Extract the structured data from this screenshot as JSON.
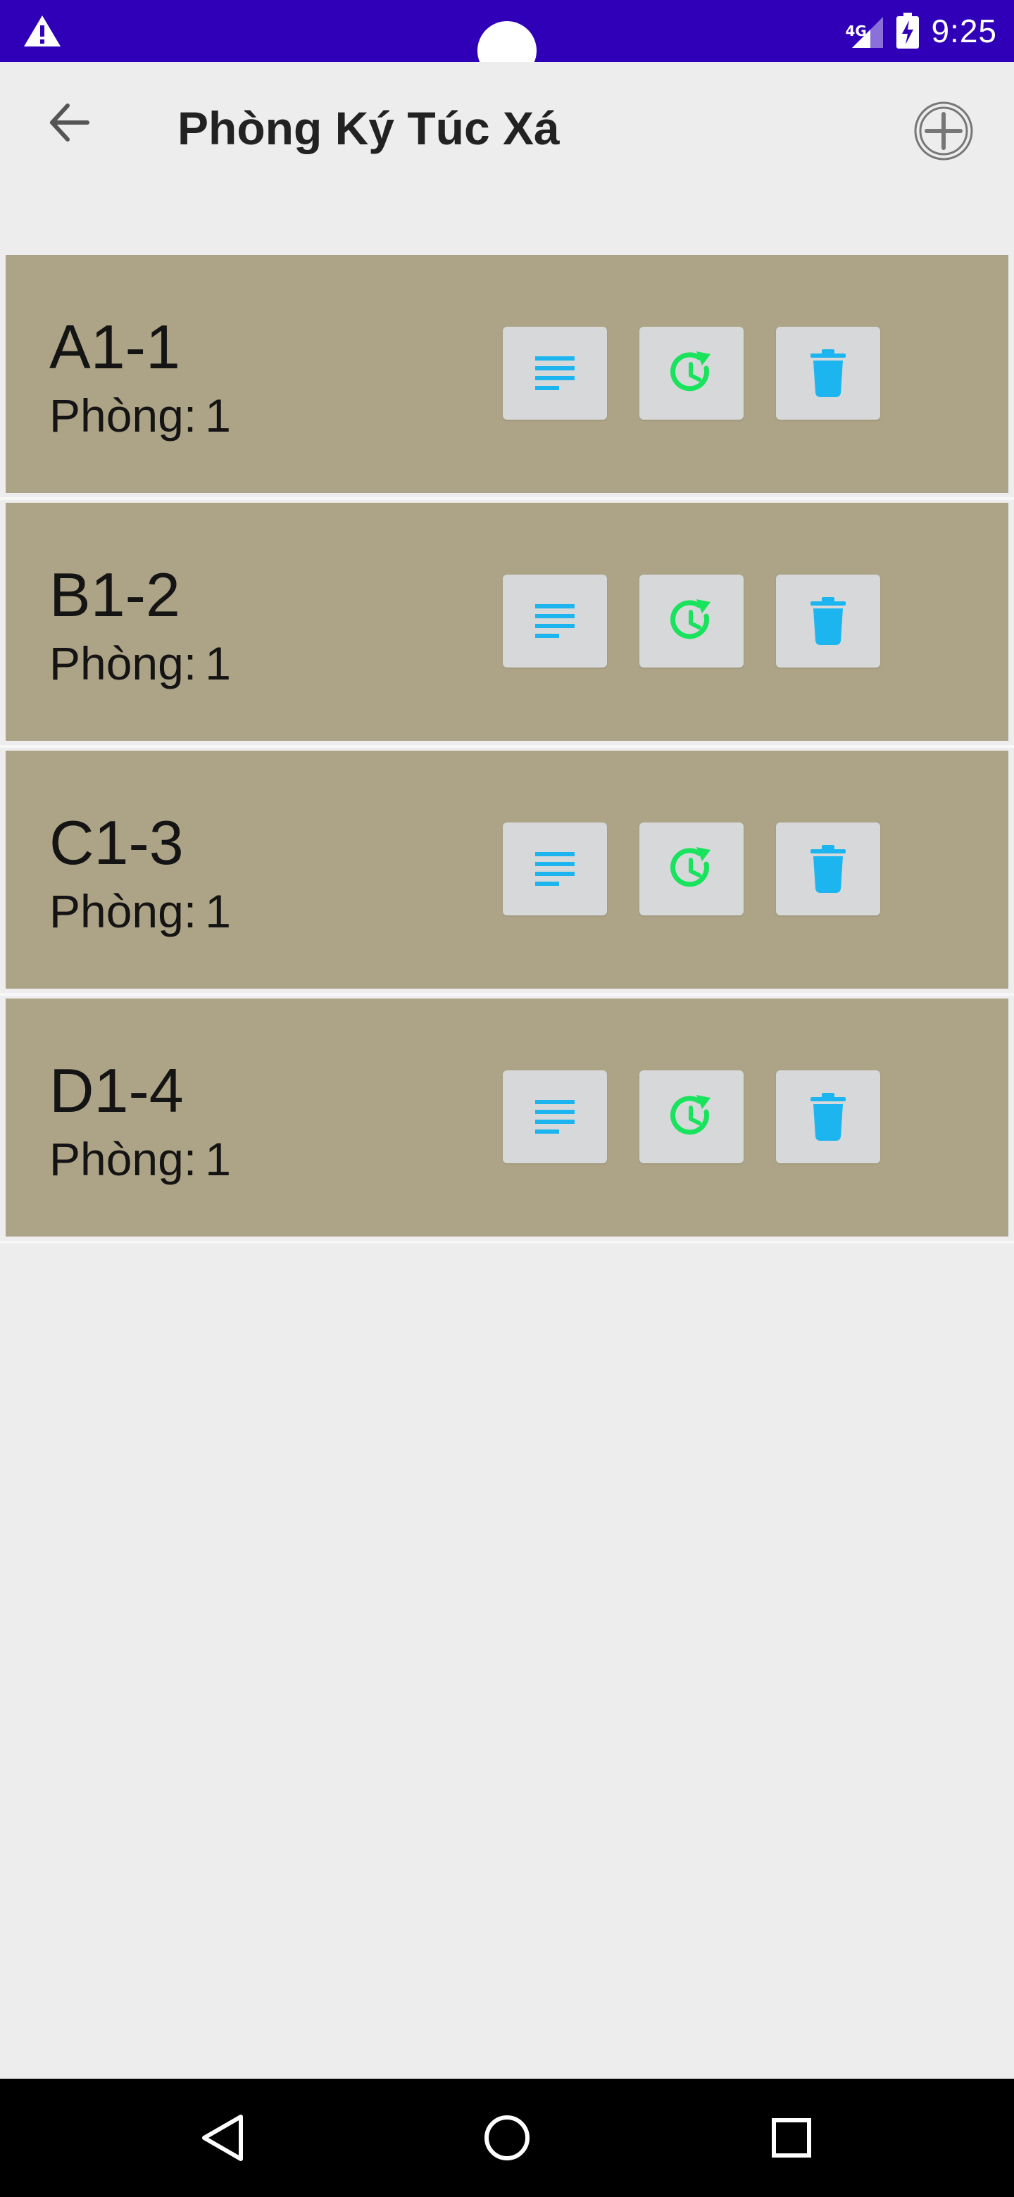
{
  "status_bar": {
    "network": "4G",
    "time": "9:25",
    "icons": [
      "alert-icon",
      "signal-icon",
      "battery-charging-icon"
    ]
  },
  "app_bar": {
    "title": "Phòng Ký Túc Xá",
    "back_icon": "arrow-back-icon",
    "add_icon": "add-circle-icon"
  },
  "rooms": [
    {
      "name": "A1-1",
      "count_label": "Phòng:",
      "count": "1"
    },
    {
      "name": "B1-2",
      "count_label": "Phòng:",
      "count": "1"
    },
    {
      "name": "C1-3",
      "count_label": "Phòng:",
      "count": "1"
    },
    {
      "name": "D1-4",
      "count_label": "Phòng:",
      "count": "1"
    }
  ],
  "room_actions": {
    "icons": [
      "details-icon",
      "history-icon",
      "delete-icon"
    ]
  },
  "colors": {
    "status_bar": "#2f00b8",
    "card": "#ada386",
    "background": "#ededed",
    "action_blue": "#1cb5ef",
    "action_green": "#19e35c",
    "nav_bar": "#000000"
  },
  "nav_bar": {
    "icons": [
      "back-triangle-icon",
      "home-circle-icon",
      "recents-square-icon"
    ]
  }
}
